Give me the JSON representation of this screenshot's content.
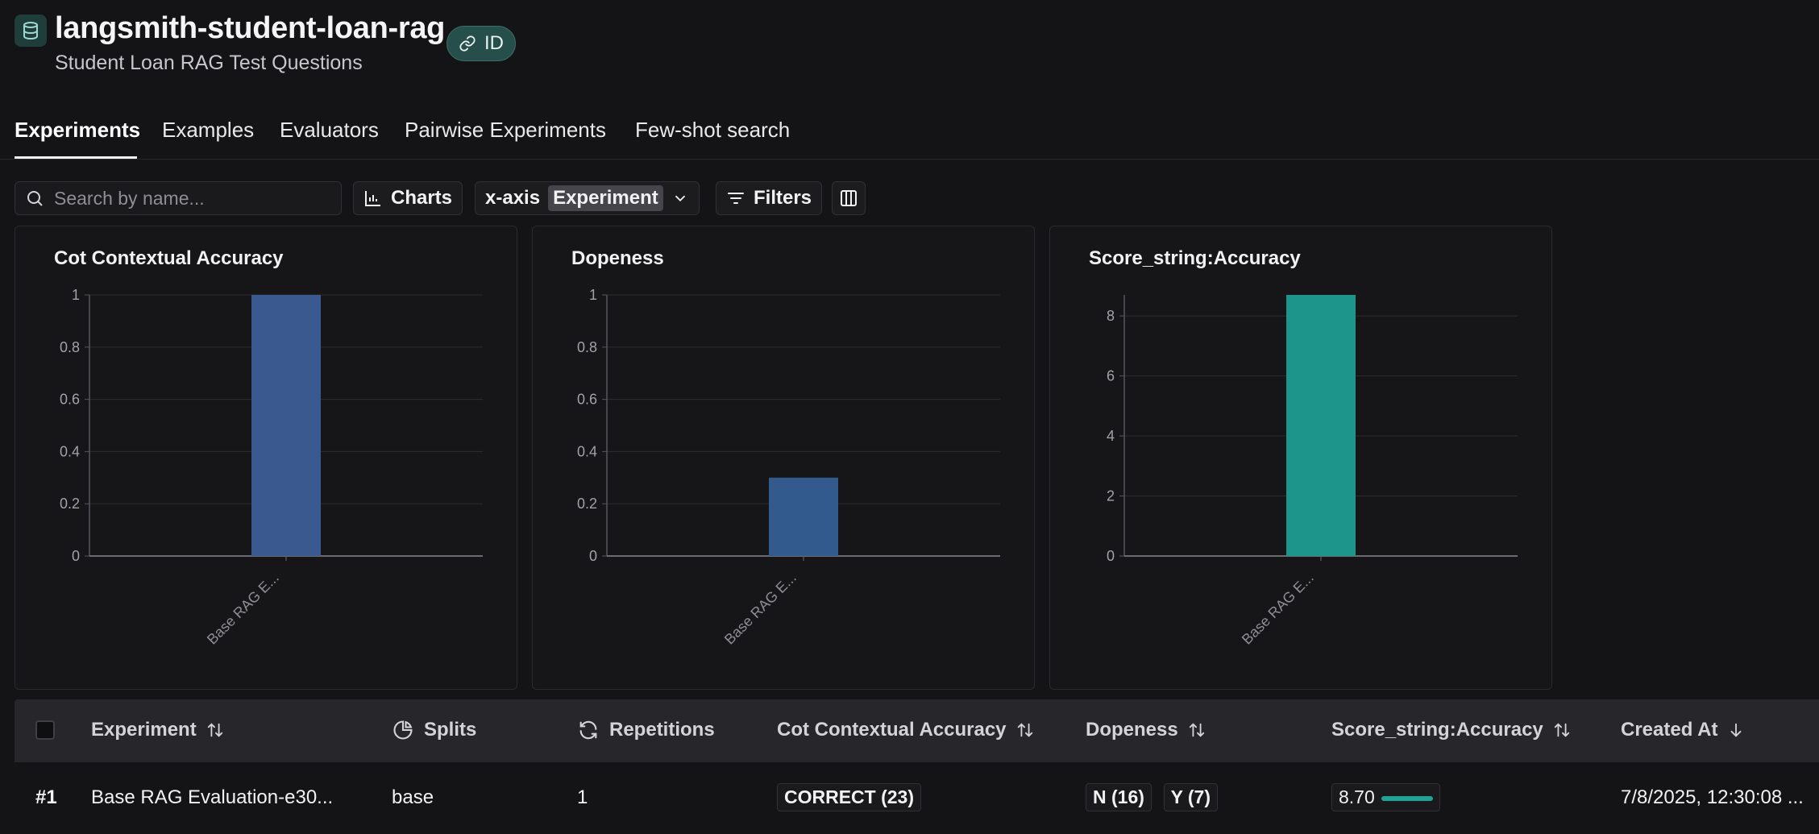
{
  "header": {
    "title": "langsmith-student-loan-rag",
    "subtitle": "Student Loan RAG Test Questions",
    "id_badge": "ID"
  },
  "tabs": [
    {
      "label": "Experiments",
      "active": true
    },
    {
      "label": "Examples",
      "active": false
    },
    {
      "label": "Evaluators",
      "active": false
    },
    {
      "label": "Pairwise Experiments",
      "active": false
    },
    {
      "label": "Few-shot search",
      "active": false
    }
  ],
  "toolbar": {
    "search_placeholder": "Search by name...",
    "charts_label": "Charts",
    "xaxis_label": "x-axis",
    "xaxis_value": "Experiment",
    "filters_label": "Filters"
  },
  "colors": {
    "bar_blue": "#3a5a8f",
    "bar_teal": "#1e958b",
    "accent": "#22a196"
  },
  "chart_data": [
    {
      "type": "bar",
      "title": "Cot Contextual Accuracy",
      "categories": [
        "Base RAG E..."
      ],
      "values": [
        1.0
      ],
      "ylim": [
        0,
        1
      ],
      "yticks": [
        "0",
        "0.2",
        "0.4",
        "0.6",
        "0.8",
        "1"
      ],
      "color": "#3a5a8f",
      "grid": true
    },
    {
      "type": "bar",
      "title": "Dopeness",
      "categories": [
        "Base RAG E..."
      ],
      "values": [
        0.3
      ],
      "ylim": [
        0,
        1
      ],
      "yticks": [
        "0",
        "0.2",
        "0.4",
        "0.6",
        "0.8",
        "1"
      ],
      "color": "#335a8c",
      "grid": true
    },
    {
      "type": "bar",
      "title": "Score_string:Accuracy",
      "categories": [
        "Base RAG E..."
      ],
      "values": [
        8.7
      ],
      "ylim": [
        0,
        8.7
      ],
      "yticks": [
        "0",
        "2",
        "4",
        "6",
        "8"
      ],
      "color": "#1e958b",
      "grid": true
    }
  ],
  "table": {
    "headers": {
      "experiment": "Experiment",
      "splits": "Splits",
      "repetitions": "Repetitions",
      "cot": "Cot Contextual Accuracy",
      "dopeness": "Dopeness",
      "score": "Score_string:Accuracy",
      "created": "Created At"
    },
    "rows": [
      {
        "index": "#1",
        "experiment": "Base RAG Evaluation-e30...",
        "splits": "base",
        "repetitions": "1",
        "cot": "CORRECT (23)",
        "dopeness_n": "N (16)",
        "dopeness_y": "Y (7)",
        "score": "8.70",
        "score_fraction": 0.87,
        "created": "7/8/2025, 12:30:08 ..."
      }
    ]
  }
}
